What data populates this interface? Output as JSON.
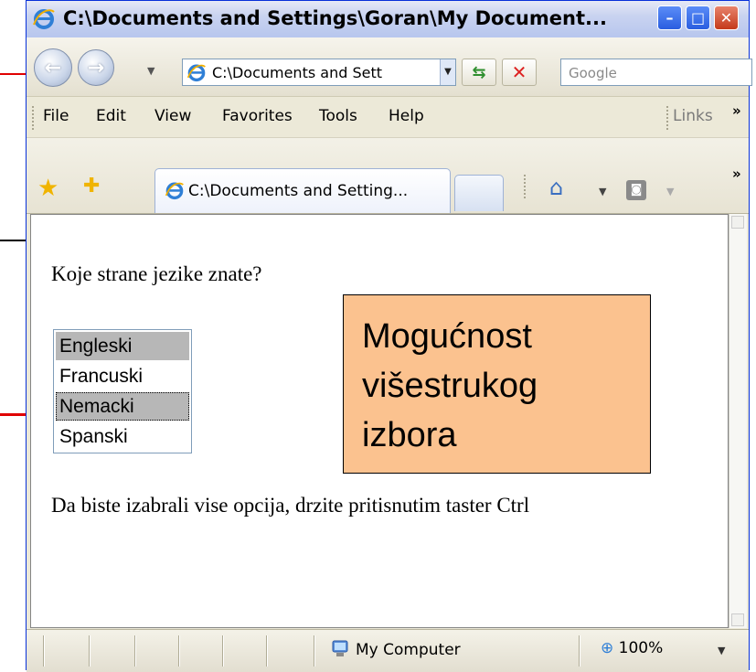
{
  "window": {
    "title": "C:\\Documents and Settings\\Goran\\My Document...",
    "min_label": "–",
    "max_label": "□",
    "close_label": "✕"
  },
  "toolbar": {
    "back_icon": "back-arrow",
    "forward_icon": "forward-arrow",
    "address_value": "C:\\Documents and Sett",
    "search_placeholder": "Google"
  },
  "menu": {
    "items": [
      "File",
      "Edit",
      "View",
      "Favorites",
      "Tools",
      "Help"
    ],
    "links_label": "Links",
    "chevron": "»"
  },
  "tabs": {
    "active_tab_title": "C:\\Documents and Setting...",
    "chevron": "»"
  },
  "page": {
    "question": "Koje strane jezike znate?",
    "options": [
      {
        "label": "Engleski",
        "selected": true
      },
      {
        "label": "Francuski",
        "selected": false
      },
      {
        "label": "Nemacki",
        "selected": true
      },
      {
        "label": "Spanski",
        "selected": false
      }
    ],
    "hint": "Da biste izabrali vise opcija, drzite pritisnutim taster Ctrl"
  },
  "callout": {
    "text": "Mogućnost višestrukog izbora",
    "background": "#fbc28f"
  },
  "statusbar": {
    "zone": "My Computer",
    "zoom": "100%"
  },
  "colors": {
    "annotation_red": "#e00000",
    "selection_gray": "#b7b7b7"
  }
}
